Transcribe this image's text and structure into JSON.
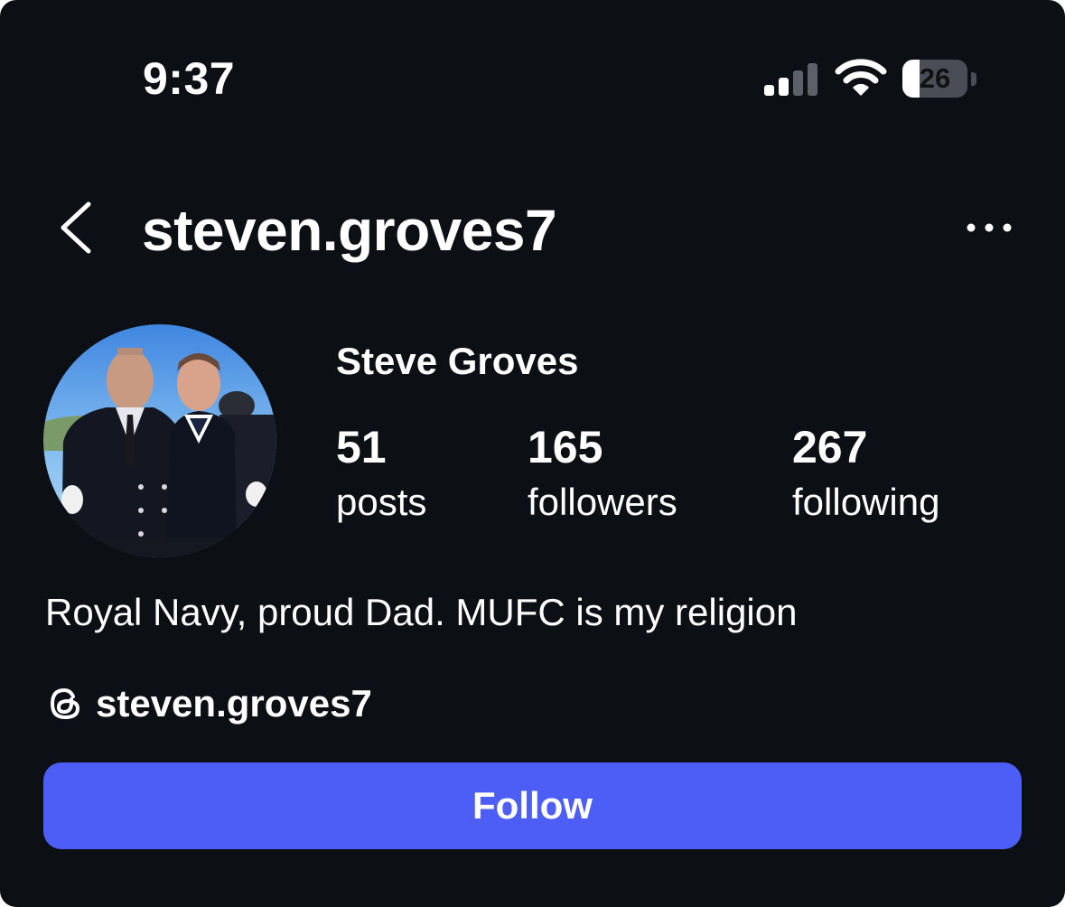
{
  "status_bar": {
    "time": "9:37",
    "battery_percent": "26",
    "battery_level": 0.26,
    "signal_bars_active": 2,
    "signal_bars_total": 4
  },
  "header": {
    "username": "steven.groves7",
    "back_icon": "chevron-left-icon",
    "more_icon": "more-horizontal-icon"
  },
  "profile": {
    "display_name": "Steve Groves",
    "stats": {
      "posts_count": "51",
      "posts_label": "posts",
      "followers_count": "165",
      "followers_label": "followers",
      "following_count": "267",
      "following_label": "following"
    },
    "bio": "Royal Navy, proud Dad. MUFC is my religion",
    "threads": {
      "icon": "threads-icon",
      "handle": "steven.groves7"
    }
  },
  "actions": {
    "follow_label": "Follow"
  },
  "colors": {
    "background": "#0c0f14",
    "text": "#ffffff",
    "follow_button": "#4d5ef6"
  }
}
